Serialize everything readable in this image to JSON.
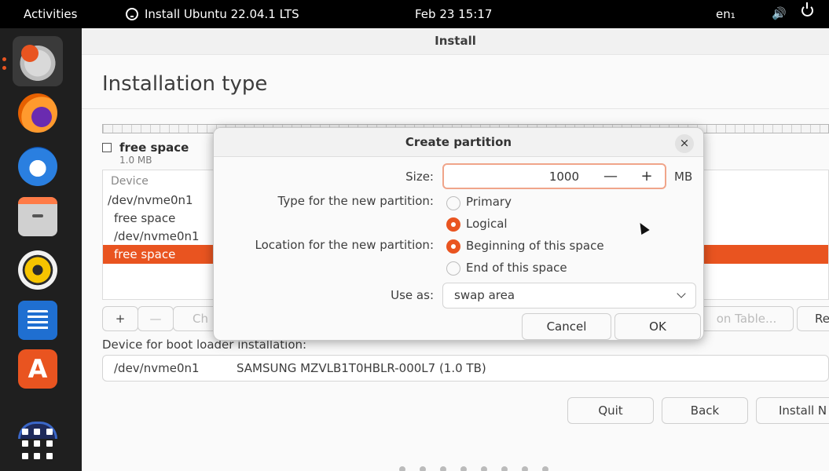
{
  "topbar": {
    "activities": "Activities",
    "app_name": "Install Ubuntu 22.04.1 LTS",
    "datetime": "Feb 23  15:17",
    "language": "en₁"
  },
  "dock": {
    "items": [
      "ubuntu-installer-icon",
      "firefox-icon",
      "thunderbird-icon",
      "files-icon",
      "rhythmbox-icon",
      "libreoffice-writer-icon",
      "ubuntu-software-icon",
      "partial-app-icon",
      "show-apps-icon"
    ]
  },
  "window": {
    "title": "Install",
    "page_title": "Installation type",
    "legend": {
      "label": "free space",
      "size": "1.0 MB"
    },
    "table": {
      "header": "Device",
      "rows": [
        {
          "device": "/dev/nvme0n1",
          "selected": false
        },
        {
          "device": "free space",
          "selected": false
        },
        {
          "device": "/dev/nvme0n1",
          "selected": false
        },
        {
          "device": "free space",
          "selected": true
        }
      ]
    },
    "buttons": {
      "add": "+",
      "remove": "—",
      "change_partial": "Ch",
      "new_table_partial": "on Table...",
      "revert_partial": "Re"
    },
    "boot_loader": {
      "label": "Device for boot loader installation:",
      "device": "/dev/nvme0n1",
      "model": "SAMSUNG MZVLB1T0HBLR-000L7 (1.0 TB)"
    },
    "nav": {
      "quit": "Quit",
      "back": "Back",
      "install_partial": "Install N"
    }
  },
  "dialog": {
    "title": "Create partition",
    "close": "×",
    "size": {
      "label": "Size:",
      "value": "1000",
      "minus": "—",
      "plus": "+",
      "unit": "MB"
    },
    "type": {
      "label": "Type for the new partition:",
      "options": [
        "Primary",
        "Logical"
      ],
      "selected": "Logical"
    },
    "location": {
      "label": "Location for the new partition:",
      "options": [
        "Beginning of this space",
        "End of this space"
      ],
      "selected": "Beginning of this space"
    },
    "use_as": {
      "label": "Use as:",
      "value": "swap area"
    },
    "cancel": "Cancel",
    "ok": "OK"
  },
  "colors": {
    "accent": "#e95420",
    "topbar": "#000000",
    "dock": "#1f1f1f"
  }
}
